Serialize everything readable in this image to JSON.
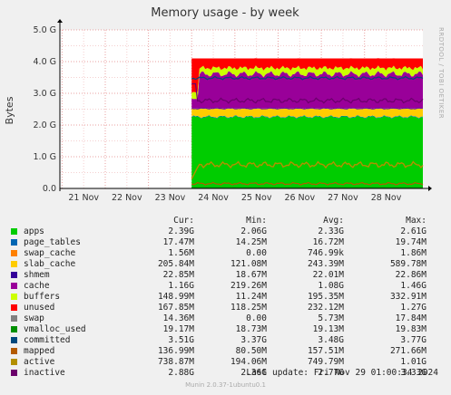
{
  "title": "Memory usage - by week",
  "side_text": "RRDTOOL / TOBI OETIKER",
  "last_update": "Last update: Fri Nov 29 01:00:34 2024",
  "footer": "Munin 2.0.37-1ubuntu0.1",
  "legend_headers": {
    "cur": "Cur:",
    "min": "Min:",
    "avg": "Avg:",
    "max": "Max:"
  },
  "chart_data": {
    "type": "area",
    "title": "Memory usage - by week",
    "ylabel": "Bytes",
    "ylim": [
      0,
      5.0
    ],
    "y_unit": "G",
    "y_ticks": [
      "0.0",
      "1.0 G",
      "2.0 G",
      "3.0 G",
      "4.0 G",
      "5.0 G"
    ],
    "x_ticks": [
      "21 Nov",
      "22 Nov",
      "23 Nov",
      "24 Nov",
      "25 Nov",
      "26 Nov",
      "27 Nov",
      "28 Nov"
    ],
    "data_start": "24 Nov",
    "grid": true,
    "stacked": [
      "apps",
      "page_tables",
      "swap_cache",
      "slab_cache",
      "shmem",
      "cache",
      "buffers",
      "unused"
    ],
    "series": [
      {
        "name": "apps",
        "color": "#00cc00",
        "cur": "2.39G",
        "min": "2.06G",
        "avg": "2.33G",
        "max": "2.61G"
      },
      {
        "name": "page_tables",
        "color": "#0066b3",
        "cur": "17.47M",
        "min": "14.25M",
        "avg": "16.72M",
        "max": "19.74M"
      },
      {
        "name": "swap_cache",
        "color": "#ff8000",
        "cur": "1.56M",
        "min": "0.00",
        "avg": "746.99k",
        "max": "1.86M"
      },
      {
        "name": "slab_cache",
        "color": "#ffcc00",
        "cur": "205.84M",
        "min": "121.08M",
        "avg": "243.39M",
        "max": "589.78M"
      },
      {
        "name": "shmem",
        "color": "#330099",
        "cur": "22.85M",
        "min": "18.67M",
        "avg": "22.01M",
        "max": "22.86M"
      },
      {
        "name": "cache",
        "color": "#990099",
        "cur": "1.16G",
        "min": "219.26M",
        "avg": "1.08G",
        "max": "1.46G"
      },
      {
        "name": "buffers",
        "color": "#ccff00",
        "cur": "148.99M",
        "min": "11.24M",
        "avg": "195.35M",
        "max": "332.91M"
      },
      {
        "name": "unused",
        "color": "#ff0000",
        "cur": "167.85M",
        "min": "118.25M",
        "avg": "232.12M",
        "max": "1.27G"
      },
      {
        "name": "swap",
        "color": "#808080",
        "cur": "14.36M",
        "min": "0.00",
        "avg": "5.73M",
        "max": "17.84M"
      },
      {
        "name": "vmalloc_used",
        "color": "#008f00",
        "cur": "19.17M",
        "min": "18.73M",
        "avg": "19.13M",
        "max": "19.83M"
      },
      {
        "name": "committed",
        "color": "#00487d",
        "cur": "3.51G",
        "min": "3.37G",
        "avg": "3.48G",
        "max": "3.77G"
      },
      {
        "name": "mapped",
        "color": "#b35a00",
        "cur": "136.99M",
        "min": "80.50M",
        "avg": "157.51M",
        "max": "271.66M"
      },
      {
        "name": "active",
        "color": "#b38f00",
        "cur": "738.87M",
        "min": "194.06M",
        "avg": "749.79M",
        "max": "1.01G"
      },
      {
        "name": "inactive",
        "color": "#6b006b",
        "cur": "2.88G",
        "min": "2.36G",
        "avg": "2.77G",
        "max": "3.33G"
      }
    ]
  }
}
